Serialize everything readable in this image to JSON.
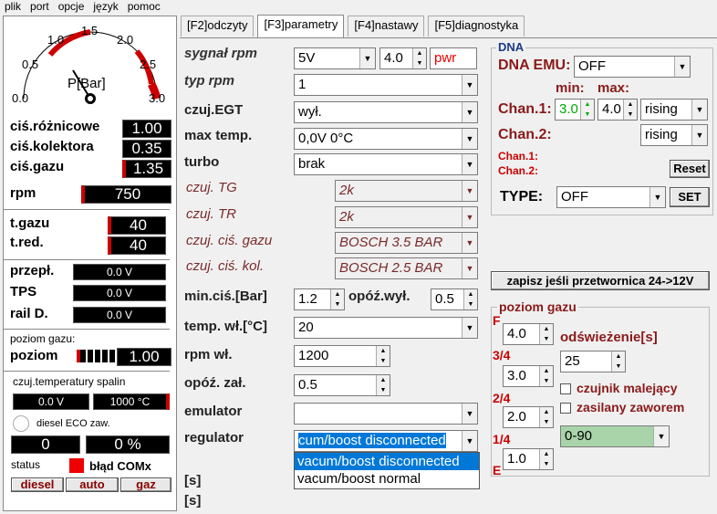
{
  "menu": [
    "plik",
    "port",
    "opcje",
    "język",
    "pomoc"
  ],
  "gauge": {
    "ticks": [
      "0.0",
      "0.5",
      "1.0",
      "1.5",
      "2.0",
      "2.5",
      "3.0"
    ],
    "unit": "P[Bar]"
  },
  "left": {
    "pdiff_label": "ciś.różnicowe",
    "pdiff": "1.00",
    "pkol_label": "ciś.kolektora",
    "pkol": "0.35",
    "pgas_label": "ciś.gazu",
    "pgas": "1.35",
    "rpm_label": "rpm",
    "rpm": "750",
    "tgas_label": "t.gazu",
    "tgas": "40",
    "tred_label": "t.red.",
    "tred": "40",
    "przep_label": "przepł.",
    "przep": "0.0 V",
    "tps_label": "TPS",
    "tps": "0.0 V",
    "rail_label": "rail D.",
    "rail": "0.0 V",
    "poziom_gazu_label": "poziom gazu:",
    "poziom_label": "poziom",
    "poziom": "1.00",
    "czuj_label": "czuj.temperatury spalin",
    "czuj_v": "0.0 V",
    "czuj_t": "1000 °C",
    "eco_label": "diesel ECO zaw.",
    "num1": "0",
    "num2": "0 %",
    "status_label": "status",
    "status_text": "błąd COMx",
    "btn_diesel": "diesel",
    "btn_auto": "auto",
    "btn_gaz": "gaz"
  },
  "tabs": [
    "[F2]odczyty",
    "[F3]parametry",
    "[F4]nastawy",
    "[F5]diagnostyka"
  ],
  "params": {
    "sygnal_label": "sygnał rpm",
    "sygnal": "5V",
    "sygnal_num": "4.0",
    "pwr": "pwr",
    "typ_label": "typ rpm",
    "typ": "1",
    "egt_label": "czuj.EGT",
    "egt": "wył.",
    "maxt_label": "max temp.",
    "maxt": "0,0V  0°C",
    "turbo_label": "turbo",
    "turbo": "brak",
    "tg_label": "czuj. TG",
    "tg": "2k",
    "tr_label": "czuj. TR",
    "tr": "2k",
    "cgaz_label": "czuj. ciś. gazu",
    "cgaz": "BOSCH 3.5 BAR",
    "ckol_label": "czuj. ciś. kol.",
    "ckol": "BOSCH 2.5 BAR",
    "minc_label": "min.ciś.[Bar]",
    "minc": "1.2",
    "opoz_label": "opóź.wył.",
    "opoz": "0.5",
    "tempw_label": "temp. wł.[°C]",
    "tempw": "20",
    "rpmw_label": "rpm wł.",
    "rpmw": "1200",
    "opozz_label": "opóź. zał.",
    "opozz": "0.5",
    "emul_label": "emulator",
    "emul": "",
    "reg_label": "regulator",
    "reg": "cum/boost disconnected",
    "reg_opts": [
      "vacum/boost disconnected",
      "vacum/boost normal"
    ],
    "s1": "[s]",
    "s2": "[s]"
  },
  "dna": {
    "title": "DNA",
    "emu_label": "DNA EMU:",
    "emu": "OFF",
    "min_label": "min:",
    "max_label": "max:",
    "ch1_label": "Chan.1:",
    "ch1_min": "3.0",
    "ch1_max": "4.0",
    "ch1_mode": "rising",
    "ch2_label": "Chan.2:",
    "ch2_mode": "rising",
    "ch1s": "Chan.1:",
    "ch2s": "Chan.2:",
    "reset": "Reset",
    "type_label": "TYPE:",
    "type": "OFF",
    "set": "SET"
  },
  "zapisz": "zapisz jeśli przetwornica 24->12V",
  "gas": {
    "title": "poziom gazu",
    "F": "F",
    "q34": "3/4",
    "q24": "2/4",
    "q14": "1/4",
    "E": "E",
    "vF": "4.0",
    "v34": "3.0",
    "v24": "2.0",
    "v14": "1.0",
    "odsw_label": "odświeżenie[s]",
    "odsw": "25",
    "malejacy": "czujnik malejący",
    "zasilany": "zasilany zaworem",
    "range": "0-90"
  }
}
